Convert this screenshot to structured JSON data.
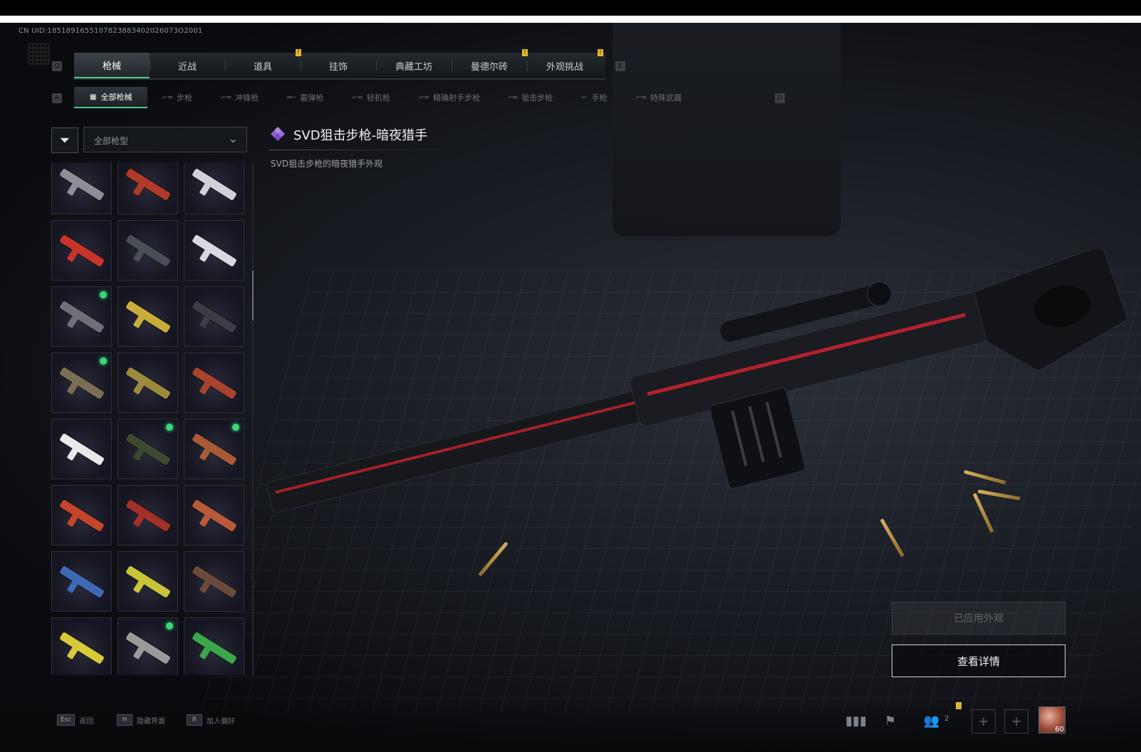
{
  "uid": "CN UID:1851891655107823883402026073O2001",
  "tabs": [
    {
      "label": "枪械",
      "active": true
    },
    {
      "label": "近战"
    },
    {
      "label": "道具",
      "badge": "!"
    },
    {
      "label": "挂饰"
    },
    {
      "label": "典藏工坊"
    },
    {
      "label": "曼德尔砖",
      "badge": "!"
    },
    {
      "label": "外观挑战",
      "badge": "!"
    }
  ],
  "tab_keys": {
    "left": "Q",
    "right": "E"
  },
  "subtabs": [
    {
      "label": "全部枪械",
      "active": true
    },
    {
      "label": "步枪"
    },
    {
      "label": "冲锋枪"
    },
    {
      "label": "霰弹枪"
    },
    {
      "label": "轻机枪"
    },
    {
      "label": "精确射手步枪"
    },
    {
      "label": "狙击步枪"
    },
    {
      "label": "手枪"
    },
    {
      "label": "特殊武器"
    }
  ],
  "subtab_keys": {
    "left": "A",
    "right": "D"
  },
  "filter": {
    "selected": "全部枪型"
  },
  "item": {
    "title": "SVD狙击步枪-暗夜猎手",
    "description": "SVD狙击步枪的暗夜猎手外观"
  },
  "grid_items": [
    {
      "color": "#8c8f94"
    },
    {
      "color": "#b23a2a",
      "dot": false
    },
    {
      "color": "#cfd2d6"
    },
    {
      "color": "#c9342a"
    },
    {
      "color": "#4a4e55"
    },
    {
      "color": "#d8dadd"
    },
    {
      "color": "#6d7076",
      "dot": true
    },
    {
      "color": "#c9ad3a"
    },
    {
      "color": "#3a3d44"
    },
    {
      "color": "#7a6f55",
      "dot": true
    },
    {
      "color": "#9b8a3e"
    },
    {
      "color": "#a8442d"
    },
    {
      "color": "#e8e9ea"
    },
    {
      "color": "#3e4a2f",
      "dot": true
    },
    {
      "color": "#a85a36",
      "dot": true
    },
    {
      "color": "#c3452b"
    },
    {
      "color": "#a3302a"
    },
    {
      "color": "#b85a3a"
    },
    {
      "color": "#3f68b5"
    },
    {
      "color": "#c9c43a"
    },
    {
      "color": "#6a4a3a"
    },
    {
      "color": "#d8c93a"
    },
    {
      "color": "#9a9a9a",
      "dot": true
    },
    {
      "color": "#3aa84a"
    }
  ],
  "buttons": {
    "applied": "已应用外观",
    "details": "查看详情"
  },
  "bottom_hints": [
    {
      "key": "Esc",
      "label": "返回"
    },
    {
      "key": "H",
      "label": "隐藏界面"
    },
    {
      "key": "R",
      "label": "加入偏好"
    }
  ],
  "social": {
    "friend_count": "2",
    "avatar_level": "60"
  },
  "icons": {
    "filter": "filter-icon",
    "chevron": "chevron-down-icon",
    "stats": "stats-icon",
    "flag": "flag-icon",
    "friends": "friends-icon",
    "plus": "plus-icon"
  },
  "colors": {
    "accent_green": "#52c882",
    "badge_yellow": "#e3b72d",
    "new_dot": "#39d877",
    "title_icon": "#a87ad8"
  }
}
